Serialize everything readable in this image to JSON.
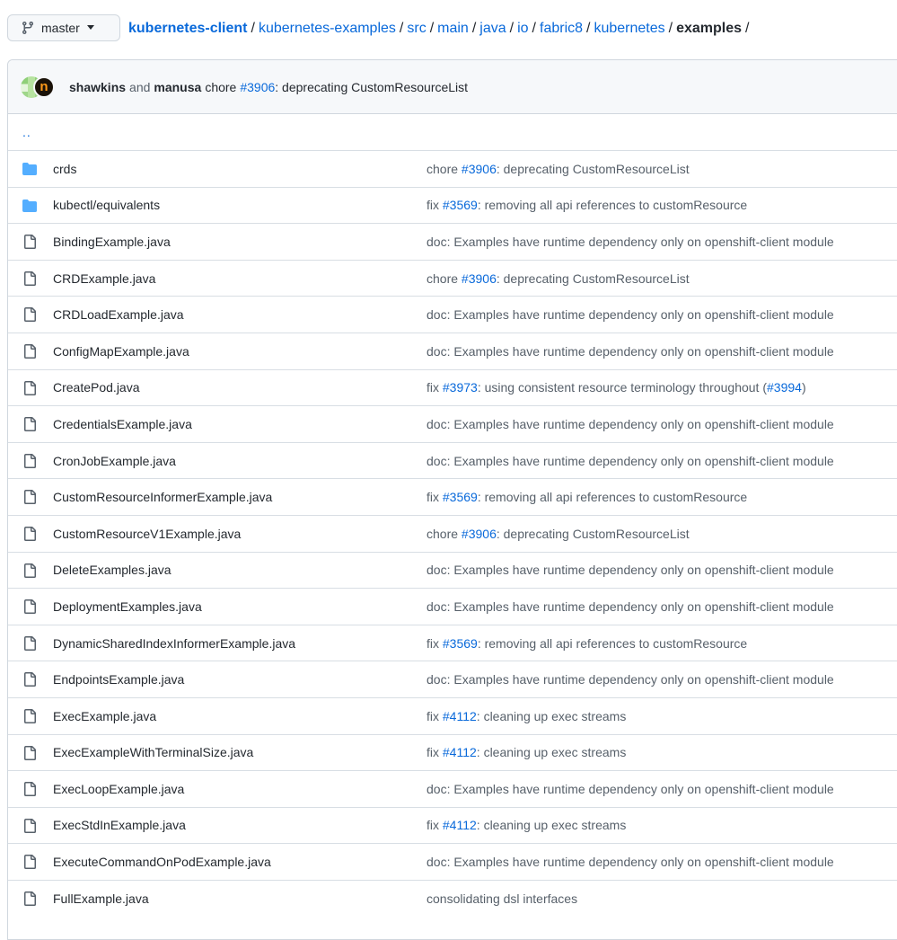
{
  "header": {
    "branch": "master",
    "breadcrumb": [
      {
        "label": "kubernetes-client",
        "kind": "repo"
      },
      {
        "label": "kubernetes-examples",
        "kind": "link"
      },
      {
        "label": "src",
        "kind": "link"
      },
      {
        "label": "main",
        "kind": "link"
      },
      {
        "label": "java",
        "kind": "link"
      },
      {
        "label": "io",
        "kind": "link"
      },
      {
        "label": "fabric8",
        "kind": "link"
      },
      {
        "label": "kubernetes",
        "kind": "link"
      },
      {
        "label": "examples",
        "kind": "current"
      }
    ],
    "trailing_separator": "/"
  },
  "commit": {
    "author1": "shawkins",
    "joiner": "and",
    "author2": "manusa",
    "prefix": "chore",
    "ref": "#3906",
    "message": ": deprecating CustomResourceList"
  },
  "parent_link": "..",
  "files": [
    {
      "type": "dir",
      "name": "crds",
      "msg": [
        {
          "t": "chore "
        },
        {
          "t": "#3906",
          "link": true
        },
        {
          "t": ": deprecating CustomResourceList"
        }
      ]
    },
    {
      "type": "dir",
      "name": "kubectl/equivalents",
      "msg": [
        {
          "t": "fix "
        },
        {
          "t": "#3569",
          "link": true
        },
        {
          "t": ": removing all api references to customResource"
        }
      ]
    },
    {
      "type": "file",
      "name": "BindingExample.java",
      "msg": [
        {
          "t": "doc: Examples have runtime dependency only on openshift-client module"
        }
      ]
    },
    {
      "type": "file",
      "name": "CRDExample.java",
      "msg": [
        {
          "t": "chore "
        },
        {
          "t": "#3906",
          "link": true
        },
        {
          "t": ": deprecating CustomResourceList"
        }
      ]
    },
    {
      "type": "file",
      "name": "CRDLoadExample.java",
      "msg": [
        {
          "t": "doc: Examples have runtime dependency only on openshift-client module"
        }
      ]
    },
    {
      "type": "file",
      "name": "ConfigMapExample.java",
      "msg": [
        {
          "t": "doc: Examples have runtime dependency only on openshift-client module"
        }
      ]
    },
    {
      "type": "file",
      "name": "CreatePod.java",
      "msg": [
        {
          "t": "fix "
        },
        {
          "t": "#3973",
          "link": true
        },
        {
          "t": ": using consistent resource terminology throughout ("
        },
        {
          "t": "#3994",
          "link": true
        },
        {
          "t": ")"
        }
      ]
    },
    {
      "type": "file",
      "name": "CredentialsExample.java",
      "msg": [
        {
          "t": "doc: Examples have runtime dependency only on openshift-client module"
        }
      ]
    },
    {
      "type": "file",
      "name": "CronJobExample.java",
      "msg": [
        {
          "t": "doc: Examples have runtime dependency only on openshift-client module"
        }
      ]
    },
    {
      "type": "file",
      "name": "CustomResourceInformerExample.java",
      "msg": [
        {
          "t": "fix "
        },
        {
          "t": "#3569",
          "link": true
        },
        {
          "t": ": removing all api references to customResource"
        }
      ]
    },
    {
      "type": "file",
      "name": "CustomResourceV1Example.java",
      "msg": [
        {
          "t": "chore "
        },
        {
          "t": "#3906",
          "link": true
        },
        {
          "t": ": deprecating CustomResourceList"
        }
      ]
    },
    {
      "type": "file",
      "name": "DeleteExamples.java",
      "msg": [
        {
          "t": "doc: Examples have runtime dependency only on openshift-client module"
        }
      ]
    },
    {
      "type": "file",
      "name": "DeploymentExamples.java",
      "msg": [
        {
          "t": "doc: Examples have runtime dependency only on openshift-client module"
        }
      ]
    },
    {
      "type": "file",
      "name": "DynamicSharedIndexInformerExample.java",
      "msg": [
        {
          "t": "fix "
        },
        {
          "t": "#3569",
          "link": true
        },
        {
          "t": ": removing all api references to customResource"
        }
      ]
    },
    {
      "type": "file",
      "name": "EndpointsExample.java",
      "msg": [
        {
          "t": "doc: Examples have runtime dependency only on openshift-client module"
        }
      ]
    },
    {
      "type": "file",
      "name": "ExecExample.java",
      "msg": [
        {
          "t": "fix "
        },
        {
          "t": "#4112",
          "link": true
        },
        {
          "t": ": cleaning up exec streams"
        }
      ]
    },
    {
      "type": "file",
      "name": "ExecExampleWithTerminalSize.java",
      "msg": [
        {
          "t": "fix "
        },
        {
          "t": "#4112",
          "link": true
        },
        {
          "t": ": cleaning up exec streams"
        }
      ]
    },
    {
      "type": "file",
      "name": "ExecLoopExample.java",
      "msg": [
        {
          "t": "doc: Examples have runtime dependency only on openshift-client module"
        }
      ]
    },
    {
      "type": "file",
      "name": "ExecStdInExample.java",
      "msg": [
        {
          "t": "fix "
        },
        {
          "t": "#4112",
          "link": true
        },
        {
          "t": ": cleaning up exec streams"
        }
      ]
    },
    {
      "type": "file",
      "name": "ExecuteCommandOnPodExample.java",
      "msg": [
        {
          "t": "doc: Examples have runtime dependency only on openshift-client module"
        }
      ]
    },
    {
      "type": "file",
      "name": "FullExample.java",
      "msg": [
        {
          "t": "consolidating dsl interfaces"
        }
      ]
    }
  ]
}
